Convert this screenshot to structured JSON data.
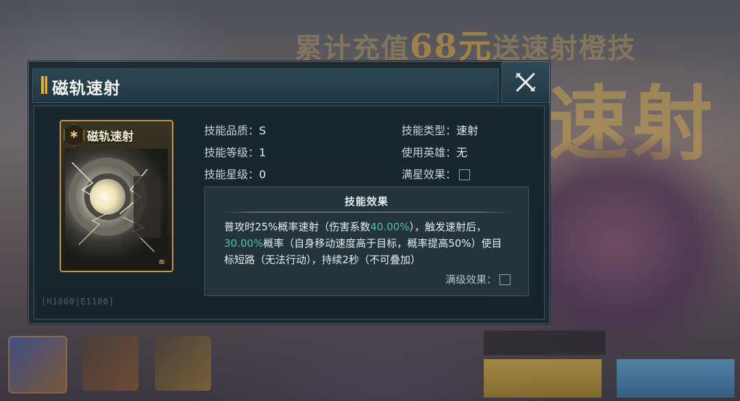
{
  "background": {
    "banner_prefix": "累计充值",
    "banner_amount": "68元",
    "banner_suffix": "送速射橙技",
    "big_text": "速射"
  },
  "dialog": {
    "title": "磁轨速射",
    "close_icon": "close-x-icon",
    "card": {
      "name": "磁轨速射",
      "badge_icon": "hexagon-emblem-icon"
    },
    "info": {
      "quality_label": "技能品质：",
      "quality_value": "S",
      "level_label": "技能等级：",
      "level_value": "1",
      "star_label": "技能星级：",
      "star_value": "0",
      "type_label": "技能类型：",
      "type_value": "速射",
      "hero_label": "使用英雄：",
      "hero_value": "无",
      "fullstar_label": "满星效果："
    },
    "effect": {
      "title": "技能效果",
      "text_1": "普攻时25%概率速射（伤害系数",
      "highlight_1": "40.00%",
      "text_2": "），触发速射后，",
      "highlight_2": "30.00%",
      "text_3": "概率（自身移动速度高于目标，概率提高50%）使目标短路（无法行动），持续2秒（不可叠加）",
      "maxlevel_label": "满级效果："
    },
    "footer_code": "[H1000|E1100]",
    "accent_color": "#4ec3a0"
  }
}
